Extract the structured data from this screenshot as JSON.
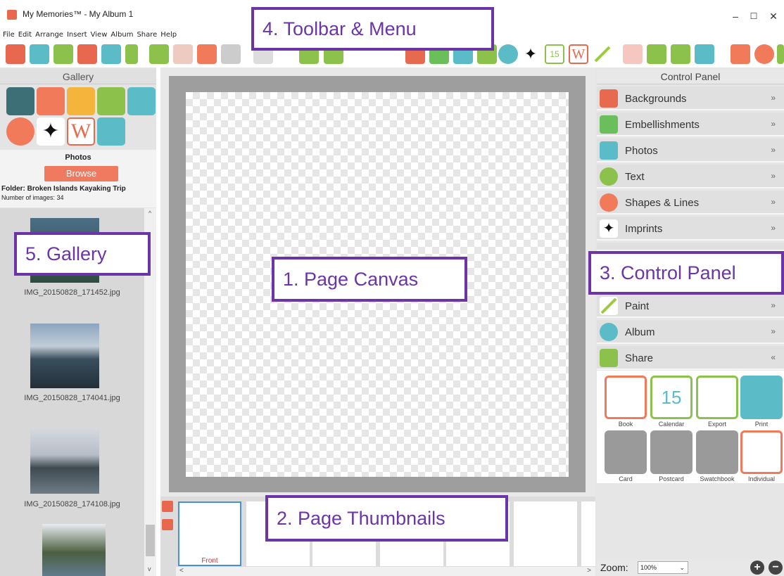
{
  "window": {
    "title": "My Memories™ - My Album 1",
    "minimize": "–",
    "maximize": "☐",
    "close": "✕"
  },
  "menu": [
    "File",
    "Edit",
    "Arrange",
    "Insert",
    "View",
    "Album",
    "Share",
    "Help"
  ],
  "toolbar": {
    "icons": [
      "my-logo-icon",
      "folder-icon",
      "storybook-icon",
      "layout-icon",
      "shape-icon",
      "add-page-icon",
      "layers-icon",
      "ruler-icon",
      "grid-icon",
      "text-tool-icon",
      "photos-icon",
      "embellish-icon",
      "backgrounds-icon",
      "text-icon",
      "shapes-icon",
      "imprint-icon",
      "calendar-icon",
      "word-icon",
      "paint-icon",
      "share-icon",
      "help-icon"
    ]
  },
  "gallery": {
    "header": "Gallery",
    "photos_title": "Photos",
    "browse": "Browse",
    "folder": "Folder: Broken Islands Kayaking Trip",
    "count": "Number of images: 34",
    "items": [
      {
        "file": "IMG_20150828_171452.jpg"
      },
      {
        "file": "IMG_20150828_174041.jpg"
      },
      {
        "file": "IMG_20150828_174108.jpg"
      }
    ]
  },
  "thumbnails": {
    "front_label": "Front"
  },
  "control_panel": {
    "header": "Control Panel",
    "rows": [
      {
        "label": "Backgrounds",
        "color": "#e86a4e"
      },
      {
        "label": "Embellishments",
        "color": "#6bbf5a"
      },
      {
        "label": "Photos",
        "color": "#5bbcc8"
      },
      {
        "label": "Text",
        "color": "#8cc24b"
      },
      {
        "label": "Shapes & Lines",
        "color": "#f07a5a"
      },
      {
        "label": "Imprints",
        "color": "#111111"
      },
      {
        "label": "Paint",
        "color": "#9ccc3c"
      },
      {
        "label": "Album",
        "color": "#5bbcc8"
      },
      {
        "label": "Share",
        "color": "#8cc24b"
      }
    ],
    "share_items": [
      {
        "label": "Book"
      },
      {
        "label": "Calendar"
      },
      {
        "label": "Export"
      },
      {
        "label": "Print"
      },
      {
        "label": "Card"
      },
      {
        "label": "Postcard"
      },
      {
        "label": "Swatchbook"
      },
      {
        "label": "Individual"
      }
    ],
    "zoom_label": "Zoom:",
    "zoom_value": "100%"
  },
  "callouts": {
    "canvas": "1. Page Canvas",
    "thumbs": "2. Page Thumbnails",
    "control": "3. Control Panel",
    "toolbar": "4. Toolbar & Menu",
    "gallery": "5. Gallery"
  },
  "calendar_day": "15"
}
